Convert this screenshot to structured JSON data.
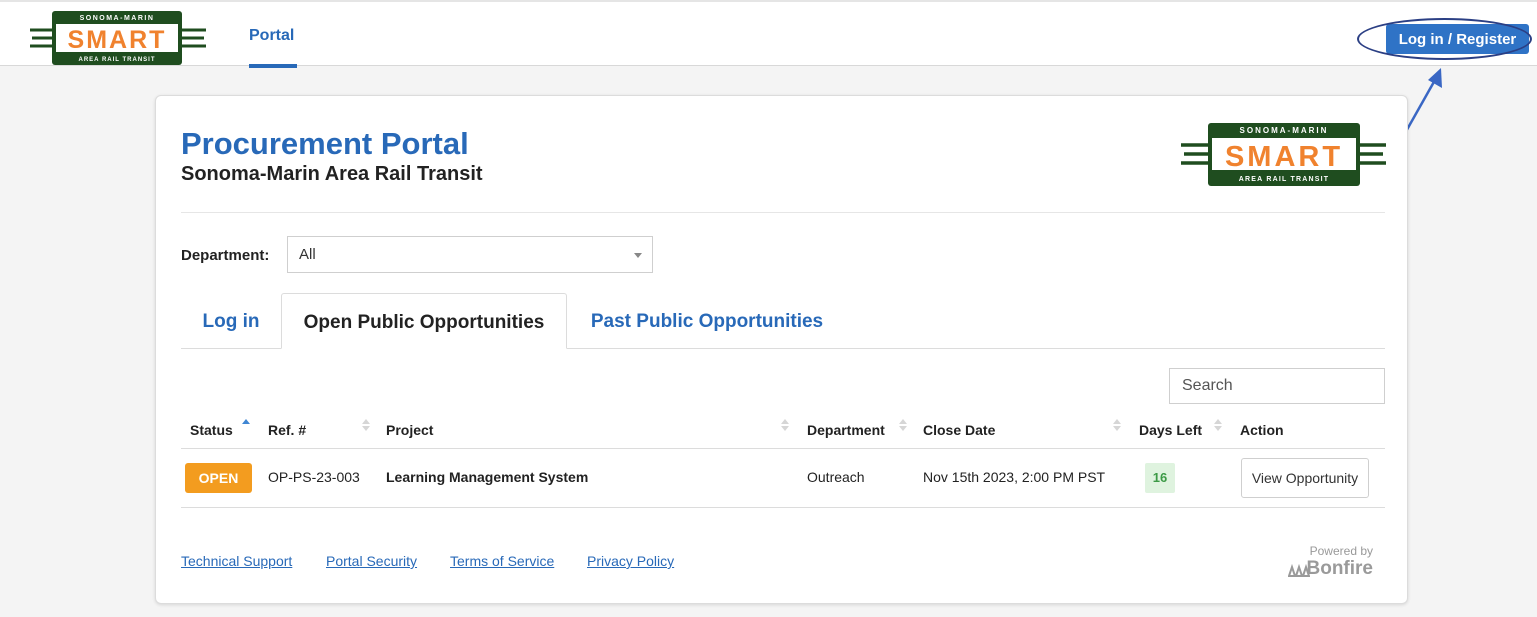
{
  "nav": {
    "logo": {
      "top_text": "SONOMA-MARIN",
      "main_text": "SMART",
      "bottom_text": "AREA RAIL TRANSIT"
    },
    "portal_label": "Portal",
    "login_label": "Log in / Register"
  },
  "colors": {
    "brand_blue": "#2869b8",
    "open_orange": "#f39c1f",
    "logo_green": "#1f4d1f",
    "logo_orange": "#f0822e"
  },
  "header": {
    "title": "Procurement Portal",
    "subtitle": "Sonoma-Marin Area Rail Transit"
  },
  "filter": {
    "label": "Department:",
    "value": "All"
  },
  "tabs": [
    {
      "label": "Log in",
      "active": false
    },
    {
      "label": "Open Public Opportunities",
      "active": true
    },
    {
      "label": "Past Public Opportunities",
      "active": false
    }
  ],
  "search": {
    "placeholder": "Search"
  },
  "table": {
    "columns": [
      "Status",
      "Ref. #",
      "Project",
      "Department",
      "Close Date",
      "Days Left",
      "Action"
    ],
    "rows": [
      {
        "status": "OPEN",
        "ref": "OP-PS-23-003",
        "project": "Learning Management System",
        "department": "Outreach",
        "close_date": "Nov 15th 2023, 2:00 PM PST",
        "days_left": "16",
        "action": "View Opportunity"
      }
    ]
  },
  "footer": {
    "links": [
      "Technical Support",
      "Portal Security",
      "Terms of Service",
      "Privacy Policy"
    ],
    "powered_by": "Powered by",
    "brand": "Bonfire"
  }
}
